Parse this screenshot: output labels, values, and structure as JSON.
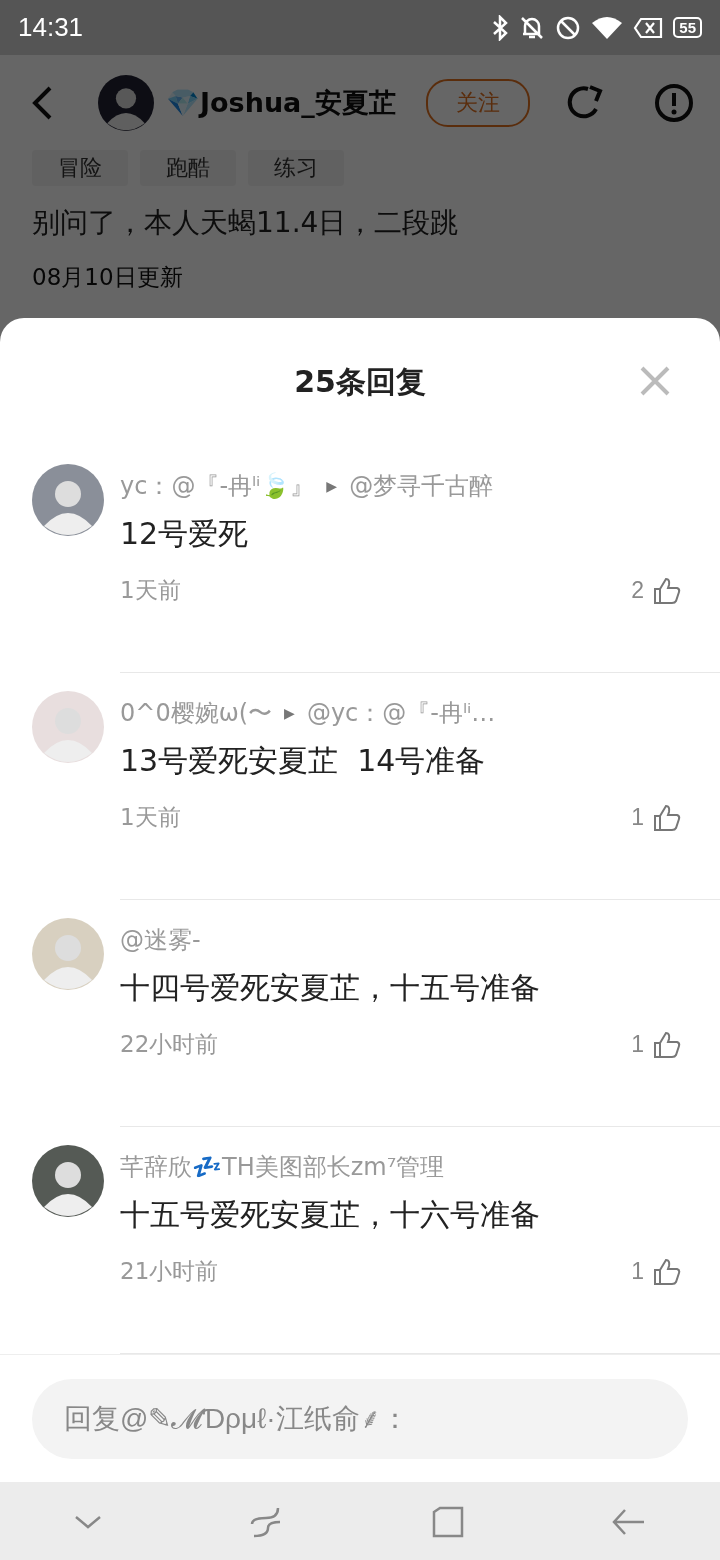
{
  "status_bar": {
    "time": "14:31",
    "battery": "55"
  },
  "header": {
    "badge": "💎",
    "username": "Joshua_安夏芷",
    "follow": "关注"
  },
  "tags": [
    "冒险",
    "跑酷",
    "练习"
  ],
  "post_text": "别问了，本人天蝎11.4日，二段跳",
  "updated": "08月10日更新",
  "sheet": {
    "title": "25条回复",
    "comments": [
      {
        "author": "yc：@『-冉ˡⁱ🍃』",
        "arrow": "▶",
        "target": "@梦寻千古醉",
        "text": "12号爱死",
        "time": "1天前",
        "likes": "2"
      },
      {
        "author": "0^0樱婉ω(〜",
        "arrow": "▶",
        "target": "@yc：@『-冉ˡⁱ…",
        "text": "13号爱死安夏芷  14号准备",
        "time": "1天前",
        "likes": "1"
      },
      {
        "author": "@迷雾-",
        "text": "十四号爱死安夏芷，十五号准备",
        "time": "22小时前",
        "likes": "1"
      },
      {
        "author": "芊辞欣💤TH美图部长zm⁷管理",
        "text": "十五号爱死安夏芷，十六号准备",
        "time": "21小时前",
        "likes": "1"
      }
    ],
    "reply_placeholder": "回复@✎𝓜Ɗρμℓ·江纸俞⸙："
  }
}
